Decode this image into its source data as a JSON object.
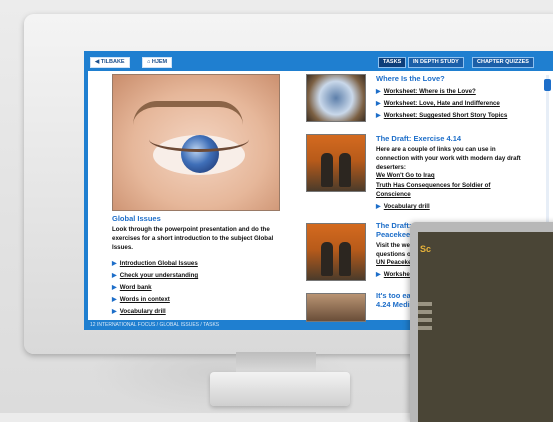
{
  "toolbar": {
    "back_label": "◀ TILBAKE",
    "home_label": "⌂ HJEM",
    "tabs": [
      {
        "label": "TASKS",
        "active": true
      },
      {
        "label": "IN DEPTH STUDY",
        "active": false
      },
      {
        "label": "CHAPTER QUIZZES",
        "active": false
      }
    ]
  },
  "left": {
    "title": "Global Issues",
    "description": "Look through the powerpoint presentation and do the exercises for a short introduction to the subject Global Issues.",
    "links": [
      "Introduction Global Issues",
      "Check your understanding",
      "Word bank",
      "Words in context",
      "Vocabulary drill"
    ]
  },
  "right": {
    "s1_title": "Where Is the Love?",
    "s1_links": [
      "Worksheet: Where is the Love?",
      "Worksheet: Love, Hate and Indifference",
      "Worksheet: Suggested Short Story Topics"
    ],
    "s2_title": "The Draft: Exercise 4.14",
    "s2_text": "Here are a couple of links you can use in connection with your work with modern day draft deserters:",
    "s2_link1": "We Won't Go to Iraq",
    "s2_link2": "Truth Has Consequences for Soldier of Conscience",
    "s2_drill": "Vocabulary drill",
    "s3_title_l1": "The Draft: Exercise 4.15 UN",
    "s3_title_l2": "Peacekeeping Fo",
    "s3_text_l1": "Visit the website bel",
    "s3_text_l2": "questions on the wo",
    "s3_link": "UN Peacekeeping",
    "s3_worksheet": "Worksheet",
    "s4_title_l1": "It's too early to cl",
    "s4_title_l2": "4.24 Media covera"
  },
  "footer": {
    "path": "12 INTERNATIONAL FOCUS / GLOBAL ISSUES / TASKS"
  },
  "tablet": {
    "title": "Sc"
  }
}
